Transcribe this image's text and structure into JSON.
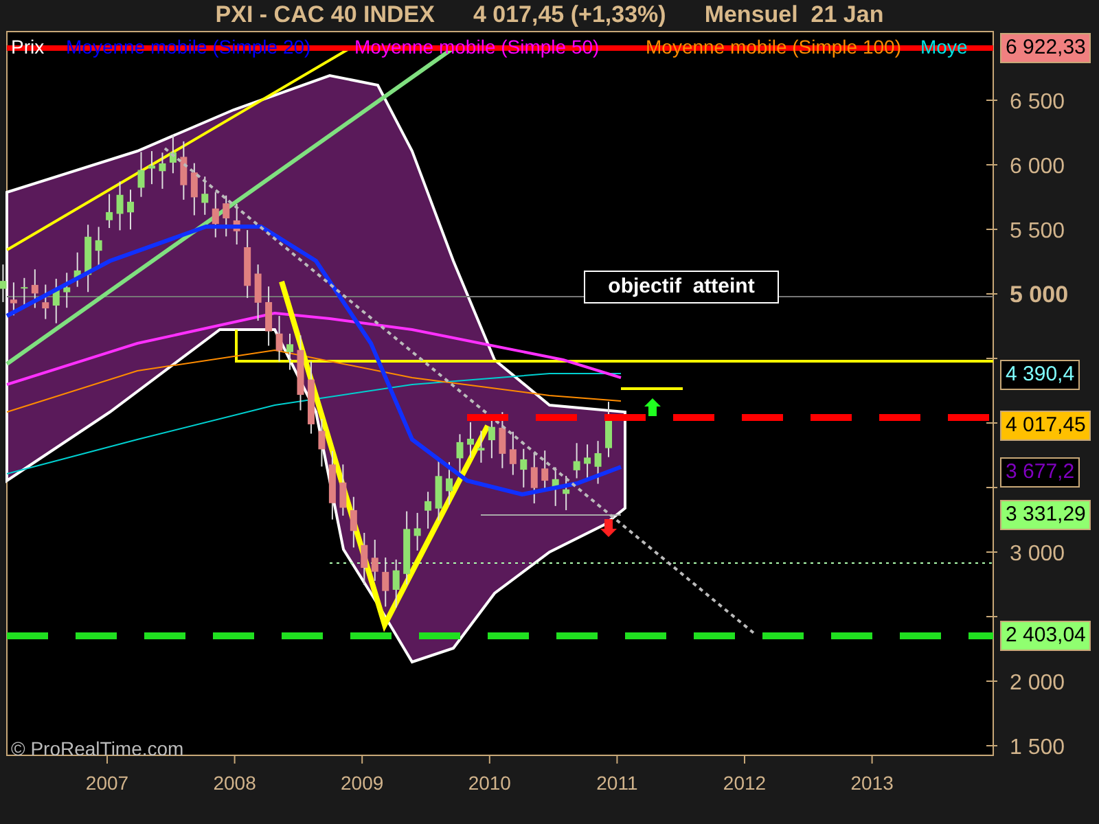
{
  "title": {
    "instrument": "PXI - CAC 40 INDEX",
    "quote": "4 017,45 (+1,33%)",
    "period": "Mensuel  21 Jan"
  },
  "legend": [
    {
      "label": "Prix",
      "color": "#ffffff"
    },
    {
      "label": "Moyenne mobile (Simple 20)",
      "color": "#0000ff"
    },
    {
      "label": "Moyenne mobile (Simple 50)",
      "color": "#ff00ff"
    },
    {
      "label": "Moyenne mobile (Simple 100)",
      "color": "#ff8c00"
    },
    {
      "label": "Moye",
      "color": "#00e5e5"
    }
  ],
  "y_axis": [
    {
      "label": "6 500",
      "bold": false
    },
    {
      "label": "6 000",
      "bold": false
    },
    {
      "label": "5 500",
      "bold": false
    },
    {
      "label": "5 000",
      "bold": true
    },
    {
      "label": "3 000",
      "bold": false
    },
    {
      "label": "2 000",
      "bold": false
    },
    {
      "label": "1 500",
      "bold": false
    }
  ],
  "x_axis": [
    "2007",
    "2008",
    "2009",
    "2010",
    "2011",
    "2012",
    "2013"
  ],
  "price_tags": [
    {
      "label": "6 922,33",
      "kind": "filled",
      "color": "#f08080"
    },
    {
      "label": "4 390,4",
      "kind": "outline",
      "color": "#80ffff"
    },
    {
      "label": "4 017,45",
      "kind": "filled",
      "color": "#ffc000"
    },
    {
      "label": "3 677,2",
      "kind": "outline",
      "color": "#8000c0"
    },
    {
      "label": "3 331,29",
      "kind": "filled",
      "color": "#90ff70"
    },
    {
      "label": "2 403,04",
      "kind": "filled",
      "color": "#90ff70"
    }
  ],
  "annotation": "objectif  atteint",
  "credit": "© ProRealTime.com"
}
